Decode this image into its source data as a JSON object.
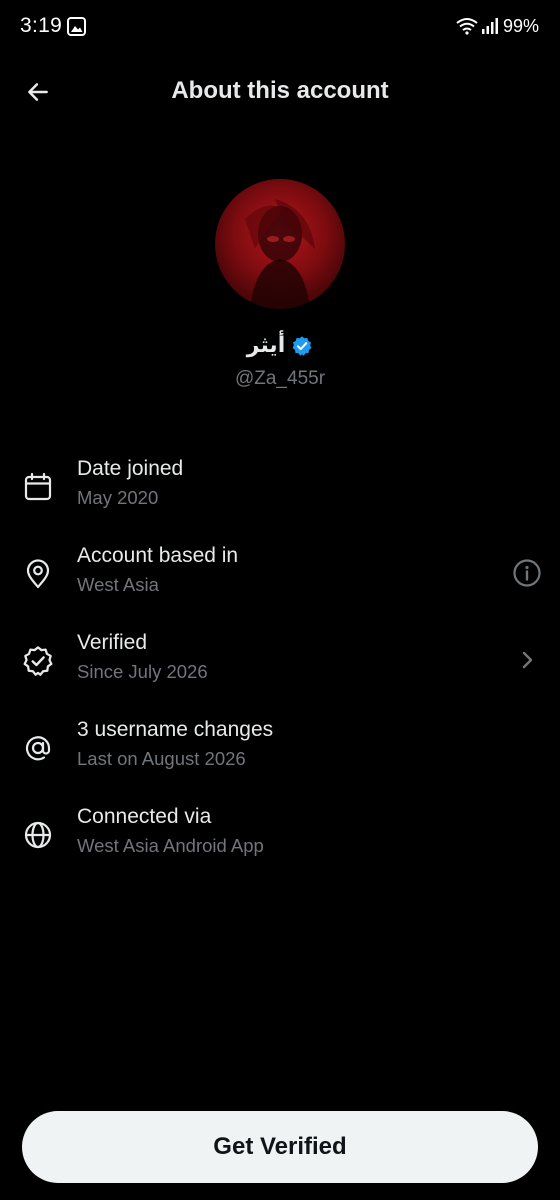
{
  "status_bar": {
    "time": "3:19",
    "battery": "99%",
    "icons": [
      "gallery-icon",
      "wifi-icon",
      "signal-icon"
    ]
  },
  "header": {
    "title": "About this account",
    "back_icon": "arrow-left-icon"
  },
  "profile": {
    "display_name": "أيثر",
    "handle": "@Za_455r",
    "verified": true,
    "badge_color": "#1d9bf0"
  },
  "info_items": [
    {
      "icon": "calendar-icon",
      "title": "Date joined",
      "subtitle": "May 2020"
    },
    {
      "icon": "location-pin-icon",
      "title": "Account based in",
      "subtitle": "West Asia",
      "trailing_icon": "info-icon"
    },
    {
      "icon": "verified-badge-outline-icon",
      "title": "Verified",
      "subtitle": "Since July 2026",
      "trailing_icon": "chevron-right-icon"
    },
    {
      "icon": "at-sign-icon",
      "title": "3 username changes",
      "subtitle": "Last on August 2026"
    },
    {
      "icon": "globe-icon",
      "title": "Connected via",
      "subtitle": "West Asia Android App"
    }
  ],
  "cta": {
    "label": "Get Verified"
  },
  "colors": {
    "background": "#000000",
    "primary_text": "#e7e9ea",
    "secondary_text": "#71767b",
    "button_bg": "#eff3f4",
    "button_text": "#0f1419"
  }
}
